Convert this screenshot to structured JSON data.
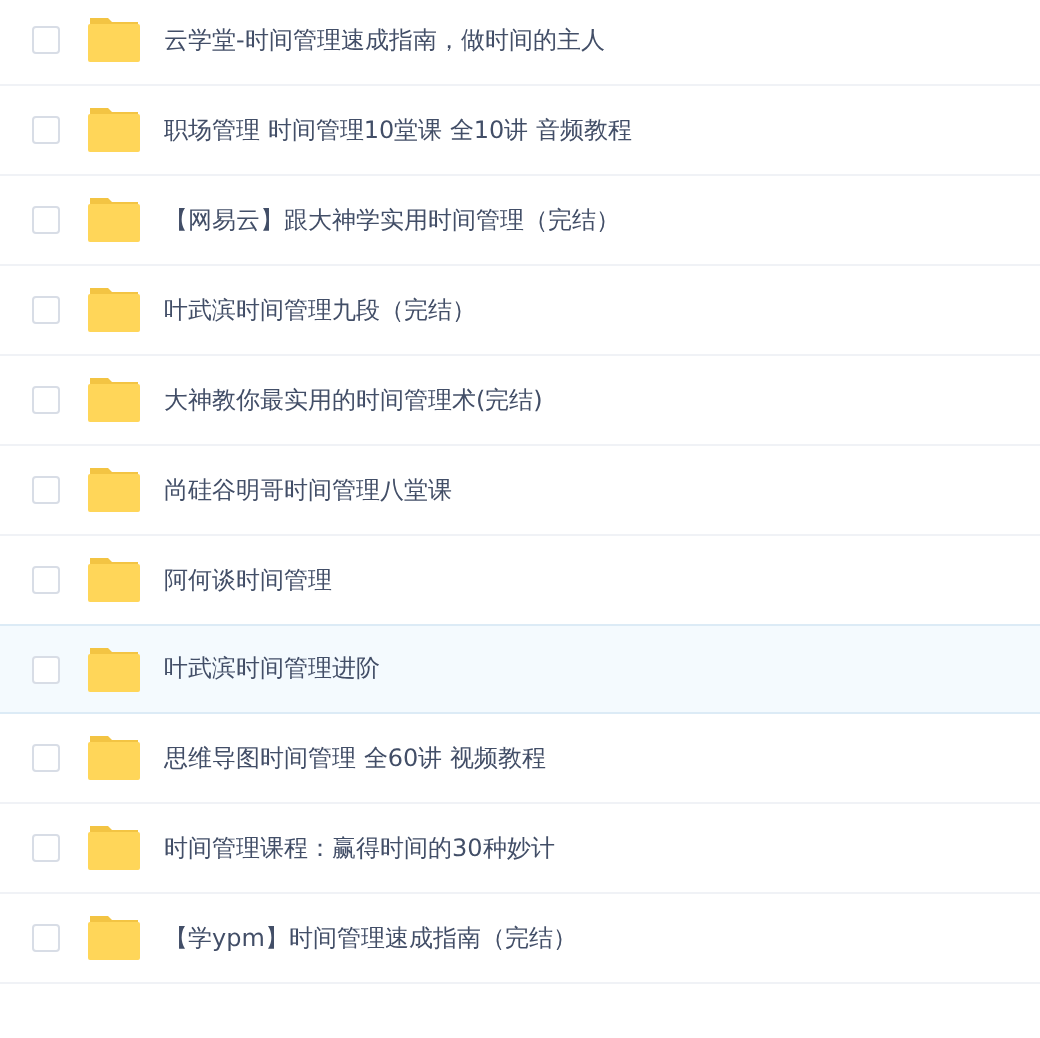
{
  "files": [
    {
      "name": "云学堂-时间管理速成指南，做时间的主人",
      "checked": false,
      "highlighted": false
    },
    {
      "name": "职场管理 时间管理10堂课 全10讲 音频教程",
      "checked": false,
      "highlighted": false
    },
    {
      "name": "【网易云】跟大神学实用时间管理（完结）",
      "checked": false,
      "highlighted": false
    },
    {
      "name": "叶武滨时间管理九段（完结）",
      "checked": false,
      "highlighted": false
    },
    {
      "name": "大神教你最实用的时间管理术(完结)",
      "checked": false,
      "highlighted": false
    },
    {
      "name": "尚硅谷明哥时间管理八堂课",
      "checked": false,
      "highlighted": false
    },
    {
      "name": "阿何谈时间管理",
      "checked": false,
      "highlighted": false
    },
    {
      "name": "叶武滨时间管理进阶",
      "checked": false,
      "highlighted": true
    },
    {
      "name": "思维导图时间管理 全60讲 视频教程",
      "checked": false,
      "highlighted": false
    },
    {
      "name": "时间管理课程：赢得时间的30种妙计",
      "checked": false,
      "highlighted": false
    },
    {
      "name": "【学ypm】时间管理速成指南（完结）",
      "checked": false,
      "highlighted": false
    }
  ]
}
